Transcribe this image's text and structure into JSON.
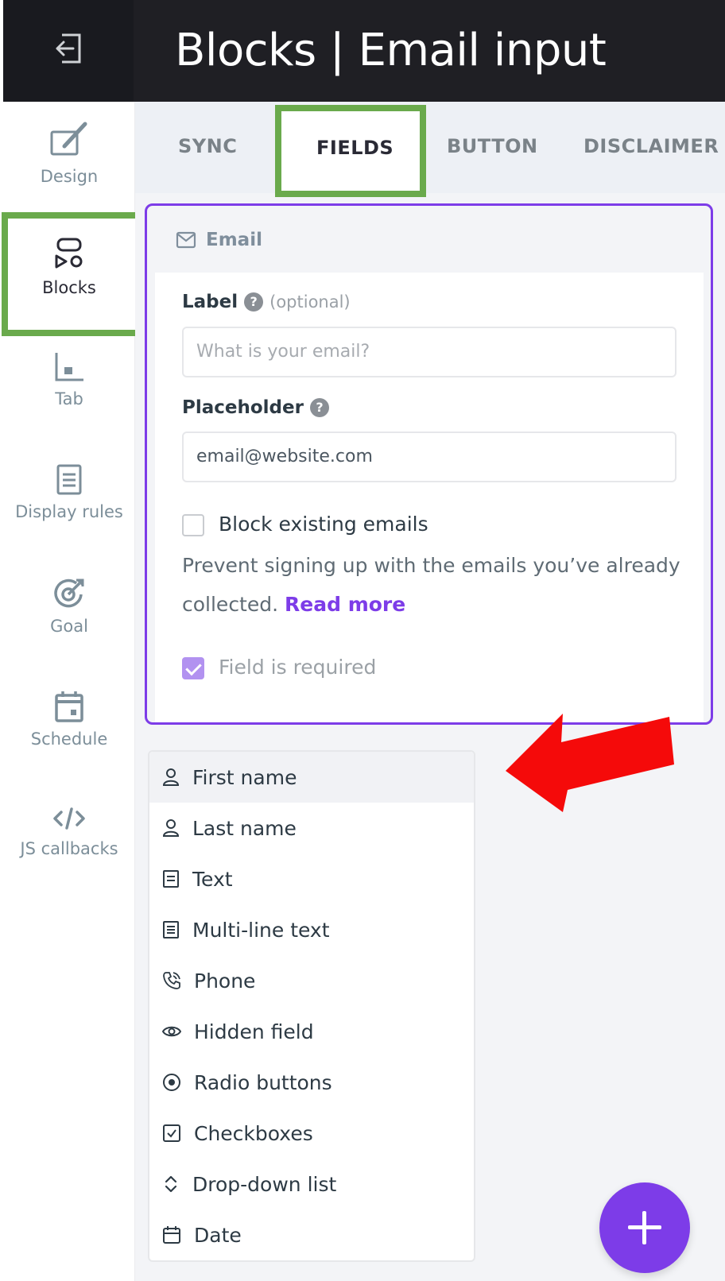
{
  "header": {
    "title": "Blocks | Email input",
    "exit_icon": "exit-icon"
  },
  "sidebar": {
    "items": [
      {
        "label": "Design",
        "icon": "design-icon"
      },
      {
        "label": "Blocks",
        "icon": "blocks-icon",
        "active": true
      },
      {
        "label": "Tab",
        "icon": "tab-icon"
      },
      {
        "label": "Display rules",
        "icon": "display-rules-icon"
      },
      {
        "label": "Goal",
        "icon": "goal-icon"
      },
      {
        "label": "Schedule",
        "icon": "schedule-icon"
      },
      {
        "label": "JS callbacks",
        "icon": "code-icon"
      }
    ]
  },
  "tabs": [
    {
      "label": "SYNC"
    },
    {
      "label": "FIELDS",
      "active": true
    },
    {
      "label": "BUTTON"
    },
    {
      "label": "DISCLAIMER"
    }
  ],
  "email_card": {
    "title": "Email",
    "label_field": {
      "label": "Label",
      "help": "?",
      "optional": "(optional)",
      "placeholder": "What is your email?"
    },
    "placeholder_field": {
      "label": "Placeholder",
      "help": "?",
      "value": "email@website.com"
    },
    "block_existing": {
      "label": "Block existing emails",
      "checked": false
    },
    "description": "Prevent signing up with the emails you’ve already collected.",
    "read_more": "Read more",
    "required": {
      "label": "Field is required",
      "checked": true
    }
  },
  "field_menu": {
    "items": [
      {
        "label": "First name",
        "icon": "person-icon"
      },
      {
        "label": "Last name",
        "icon": "person-icon"
      },
      {
        "label": "Text",
        "icon": "text-icon"
      },
      {
        "label": "Multi-line text",
        "icon": "multiline-text-icon"
      },
      {
        "label": "Phone",
        "icon": "phone-icon"
      },
      {
        "label": "Hidden field",
        "icon": "eye-icon"
      },
      {
        "label": "Radio buttons",
        "icon": "radio-icon"
      },
      {
        "label": "Checkboxes",
        "icon": "checkbox-icon"
      },
      {
        "label": "Drop-down list",
        "icon": "chevron-updown-icon"
      },
      {
        "label": "Date",
        "icon": "calendar-icon"
      }
    ]
  },
  "colors": {
    "accent": "#7d3ce8",
    "highlight": "#6aaa4c",
    "arrow": "#f50a0a",
    "topbar": "#1f1f24"
  }
}
